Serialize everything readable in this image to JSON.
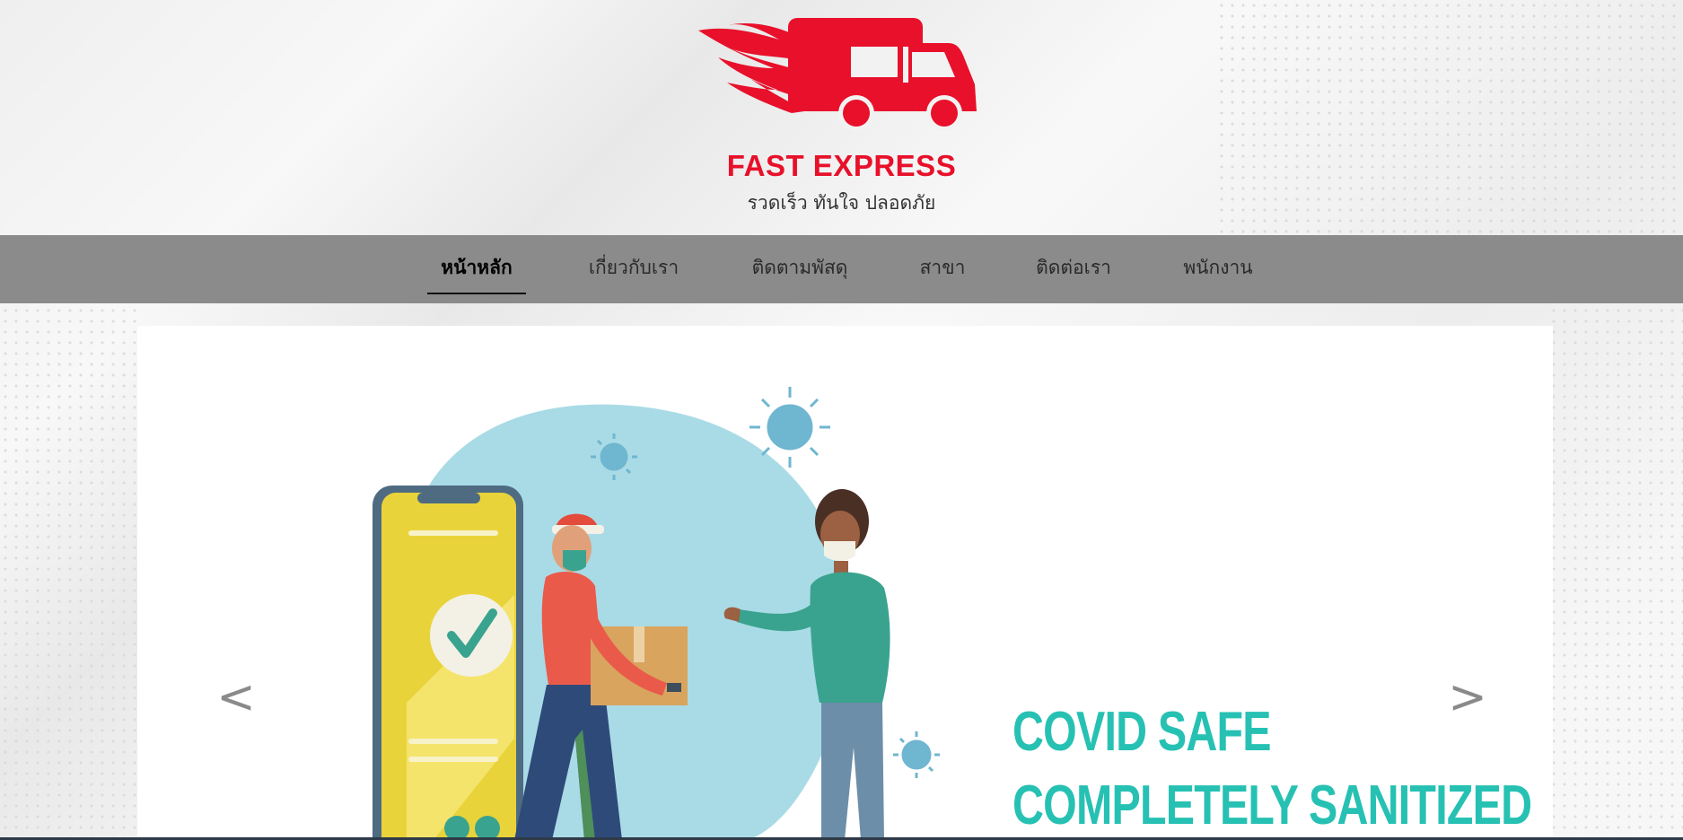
{
  "brand": {
    "name": "FAST EXPRESS",
    "tagline": "รวดเร็ว ทันใจ ปลอดภัย"
  },
  "nav": {
    "items": [
      {
        "label": "หน้าหลัก",
        "active": true
      },
      {
        "label": "เกี่ยวกับเรา",
        "active": false
      },
      {
        "label": "ติดตามพัสดุ",
        "active": false
      },
      {
        "label": "สาขา",
        "active": false
      },
      {
        "label": "ติดต่อเรา",
        "active": false
      },
      {
        "label": "พนักงาน",
        "active": false
      }
    ]
  },
  "slider": {
    "prev_label": "<",
    "next_label": ">",
    "slide": {
      "line1": "COVID SAFE",
      "line2": "COMPLETELY SANITIZED"
    }
  },
  "colors": {
    "brand_red": "#e8102a",
    "nav_bg": "#8b8b8b",
    "slide_teal": "#26c1b3",
    "blob_blue": "#a9dbe6"
  },
  "icons": {
    "logo": "truck-with-flames-icon",
    "virus": "virus-icon",
    "check": "checkmark-icon"
  }
}
